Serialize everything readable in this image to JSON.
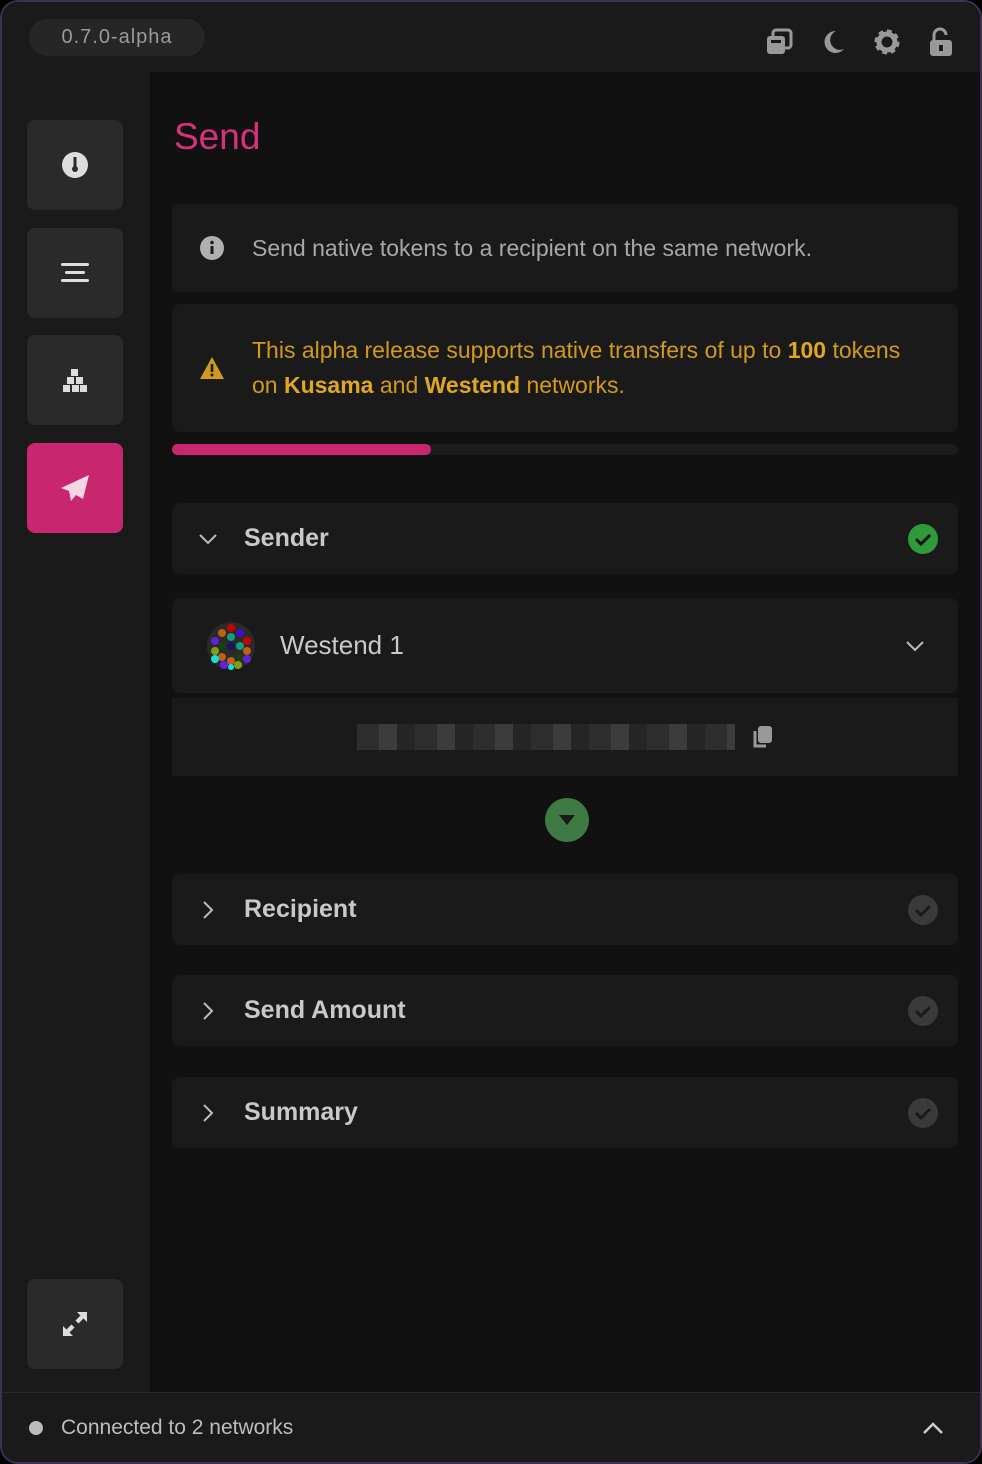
{
  "header": {
    "version": "0.7.0-alpha",
    "icons": [
      "windows-icon",
      "moon-icon",
      "gear-icon",
      "unlock-icon"
    ]
  },
  "sidebar": {
    "items": [
      {
        "name": "overview",
        "icon": "gauge-icon"
      },
      {
        "name": "accounts",
        "icon": "list-icon"
      },
      {
        "name": "networks",
        "icon": "cubes-icon"
      },
      {
        "name": "send",
        "icon": "paper-plane-icon",
        "active": true
      }
    ],
    "bottom_icon": "expand-icon"
  },
  "main": {
    "title": "Send",
    "info": "Send native tokens to a recipient on the same network.",
    "warning": {
      "t1": "This alpha release supports native transfers of up to ",
      "amount": "100",
      "t2": " tokens on ",
      "net1": "Kusama",
      "t3": " and ",
      "net2": "Westend",
      "t4": " networks."
    },
    "progress_percent": 33,
    "sections": {
      "sender": "Sender",
      "recipient": "Recipient",
      "amount": "Send Amount",
      "summary": "Summary"
    },
    "account": "Westend 1"
  },
  "footer": {
    "status": "Connected to 2 networks"
  },
  "colors": {
    "accent": "#c8266f",
    "success": "#2f9a3a",
    "warning": "#d19a1f"
  }
}
